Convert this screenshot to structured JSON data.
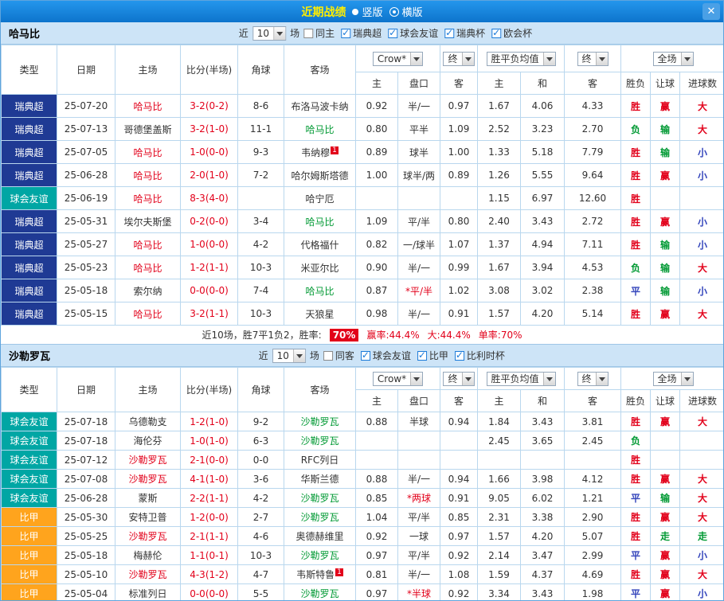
{
  "titlebar": {
    "title": "近期战绩",
    "radios": [
      {
        "label": "竖版",
        "selected": false
      },
      {
        "label": "横版",
        "selected": true
      }
    ],
    "close_icon": "✕"
  },
  "table_header": {
    "type": "类型",
    "date": "日期",
    "home": "主场",
    "score": "比分(半场)",
    "corner": "角球",
    "away": "客场",
    "odds_home": "主",
    "odds_handicap": "盘口",
    "odds_away": "客",
    "avg_home": "主",
    "avg_draw": "和",
    "avg_away": "客",
    "result_wdl": "胜负",
    "result_handicap": "让球",
    "result_goals": "进球数"
  },
  "league_colors": {
    "瑞典超": "#1f3a94",
    "球会友谊": "#00a6a4",
    "比甲": "#ffa41d"
  },
  "result_colors": {
    "胜": "#e2001a",
    "平": "#3344bb",
    "负": "#009933",
    "赢": "#e2001a",
    "输": "#009933",
    "走": "#009933",
    "大": "#e2001a",
    "小": "#3344bb"
  },
  "sections": [
    {
      "team": "哈马比",
      "filter": {
        "near": "近",
        "count": "10",
        "games": "场",
        "checkboxes": [
          {
            "label": "同主",
            "checked": false
          },
          {
            "label": "瑞典超",
            "checked": true
          },
          {
            "label": "球会友谊",
            "checked": true
          },
          {
            "label": "瑞典杯",
            "checked": true
          },
          {
            "label": "欧会杯",
            "checked": true
          }
        ]
      },
      "dropdowns": {
        "company": "Crow*",
        "final1": "终",
        "avg": "胜平负均值",
        "final2": "终",
        "scope": "全场"
      },
      "rows": [
        {
          "league": "瑞典超",
          "date": "25-07-20",
          "home": "哈马比",
          "home_cls": "t-red",
          "score": "3-2(0-2)",
          "corner": "8-6",
          "away": "布洛马波卡纳",
          "away_cls": "",
          "odds": [
            "0.92",
            "半/一",
            "0.97"
          ],
          "avg": [
            "1.67",
            "4.06",
            "4.33"
          ],
          "res": [
            "胜",
            "赢",
            "大"
          ]
        },
        {
          "league": "瑞典超",
          "date": "25-07-13",
          "home": "哥德堡盖斯",
          "home_cls": "",
          "score": "3-2(1-0)",
          "corner": "11-1",
          "away": "哈马比",
          "away_cls": "t-green",
          "odds": [
            "0.80",
            "平半",
            "1.09"
          ],
          "avg": [
            "2.52",
            "3.23",
            "2.70"
          ],
          "res": [
            "负",
            "输",
            "大"
          ]
        },
        {
          "league": "瑞典超",
          "date": "25-07-05",
          "home": "哈马比",
          "home_cls": "t-red",
          "score": "1-0(0-0)",
          "corner": "9-3",
          "away": "韦纳穆",
          "away_cls": "",
          "away_badge": "1",
          "odds": [
            "0.89",
            "球半",
            "1.00"
          ],
          "avg": [
            "1.33",
            "5.18",
            "7.79"
          ],
          "res": [
            "胜",
            "输",
            "小"
          ]
        },
        {
          "league": "瑞典超",
          "date": "25-06-28",
          "home": "哈马比",
          "home_cls": "t-red",
          "score": "2-0(1-0)",
          "corner": "7-2",
          "away": "哈尔姆斯塔德",
          "away_cls": "",
          "odds": [
            "1.00",
            "球半/两",
            "0.89"
          ],
          "avg": [
            "1.26",
            "5.55",
            "9.64"
          ],
          "res": [
            "胜",
            "赢",
            "小"
          ]
        },
        {
          "league": "球会友谊",
          "date": "25-06-19",
          "home": "哈马比",
          "home_cls": "t-red",
          "score": "8-3(4-0)",
          "corner": "",
          "away": "哈宁厄",
          "away_cls": "",
          "odds": [
            "",
            "",
            ""
          ],
          "avg": [
            "1.15",
            "6.97",
            "12.60"
          ],
          "res": [
            "胜",
            "",
            ""
          ]
        },
        {
          "league": "瑞典超",
          "date": "25-05-31",
          "home": "埃尔夫斯堡",
          "home_cls": "",
          "score": "0-2(0-0)",
          "corner": "3-4",
          "away": "哈马比",
          "away_cls": "t-green",
          "odds": [
            "1.09",
            "平/半",
            "0.80"
          ],
          "avg": [
            "2.40",
            "3.43",
            "2.72"
          ],
          "res": [
            "胜",
            "赢",
            "小"
          ]
        },
        {
          "league": "瑞典超",
          "date": "25-05-27",
          "home": "哈马比",
          "home_cls": "t-red",
          "score": "1-0(0-0)",
          "corner": "4-2",
          "away": "代格福什",
          "away_cls": "",
          "odds": [
            "0.82",
            "一/球半",
            "1.07"
          ],
          "avg": [
            "1.37",
            "4.94",
            "7.11"
          ],
          "res": [
            "胜",
            "输",
            "小"
          ]
        },
        {
          "league": "瑞典超",
          "date": "25-05-23",
          "home": "哈马比",
          "home_cls": "t-red",
          "score": "1-2(1-1)",
          "corner": "10-3",
          "away": "米亚尔比",
          "away_cls": "",
          "odds": [
            "0.90",
            "半/一",
            "0.99"
          ],
          "avg": [
            "1.67",
            "3.94",
            "4.53"
          ],
          "res": [
            "负",
            "输",
            "大"
          ]
        },
        {
          "league": "瑞典超",
          "date": "25-05-18",
          "home": "索尔纳",
          "home_cls": "",
          "score": "0-0(0-0)",
          "corner": "7-4",
          "away": "哈马比",
          "away_cls": "t-green",
          "odds": [
            "0.87",
            "*平/半",
            "1.02"
          ],
          "avg": [
            "3.08",
            "3.02",
            "2.38"
          ],
          "res": [
            "平",
            "输",
            "小"
          ]
        },
        {
          "league": "瑞典超",
          "date": "25-05-15",
          "home": "哈马比",
          "home_cls": "t-red",
          "score": "3-2(1-1)",
          "corner": "10-3",
          "away": "天狼星",
          "away_cls": "",
          "odds": [
            "0.98",
            "半/一",
            "0.91"
          ],
          "avg": [
            "1.57",
            "4.20",
            "5.14"
          ],
          "res": [
            "胜",
            "赢",
            "大"
          ]
        }
      ],
      "summary": {
        "prefix": "近10场，胜7平1负2，胜率:",
        "rate": "70%",
        "stats": [
          "赢率:44.4%",
          "大:44.4%",
          "单率:70%"
        ]
      }
    },
    {
      "team": "沙勒罗瓦",
      "filter": {
        "near": "近",
        "count": "10",
        "games": "场",
        "checkboxes": [
          {
            "label": "同客",
            "checked": false
          },
          {
            "label": "球会友谊",
            "checked": true
          },
          {
            "label": "比甲",
            "checked": true
          },
          {
            "label": "比利时杯",
            "checked": true
          }
        ]
      },
      "dropdowns": {
        "company": "Crow*",
        "final1": "终",
        "avg": "胜平负均值",
        "final2": "终",
        "scope": "全场"
      },
      "rows": [
        {
          "league": "球会友谊",
          "date": "25-07-18",
          "home": "乌德勒支",
          "home_cls": "",
          "score": "1-2(1-0)",
          "corner": "9-2",
          "away": "沙勒罗瓦",
          "away_cls": "t-green",
          "odds": [
            "0.88",
            "半球",
            "0.94"
          ],
          "avg": [
            "1.84",
            "3.43",
            "3.81"
          ],
          "res": [
            "胜",
            "赢",
            "大"
          ]
        },
        {
          "league": "球会友谊",
          "date": "25-07-18",
          "home": "海伦芬",
          "home_cls": "",
          "score": "1-0(1-0)",
          "corner": "6-3",
          "away": "沙勒罗瓦",
          "away_cls": "t-green",
          "odds": [
            "",
            "",
            ""
          ],
          "avg": [
            "2.45",
            "3.65",
            "2.45"
          ],
          "res": [
            "负",
            "",
            ""
          ]
        },
        {
          "league": "球会友谊",
          "date": "25-07-12",
          "home": "沙勒罗瓦",
          "home_cls": "t-red",
          "score": "2-1(0-0)",
          "corner": "0-0",
          "away": "RFC列日",
          "away_cls": "",
          "odds": [
            "",
            "",
            ""
          ],
          "avg": [
            "",
            "",
            ""
          ],
          "res": [
            "胜",
            "",
            ""
          ]
        },
        {
          "league": "球会友谊",
          "date": "25-07-08",
          "home": "沙勒罗瓦",
          "home_cls": "t-red",
          "score": "4-1(1-0)",
          "corner": "3-6",
          "away": "华斯兰德",
          "away_cls": "",
          "odds": [
            "0.88",
            "半/一",
            "0.94"
          ],
          "avg": [
            "1.66",
            "3.98",
            "4.12"
          ],
          "res": [
            "胜",
            "赢",
            "大"
          ]
        },
        {
          "league": "球会友谊",
          "date": "25-06-28",
          "home": "蒙斯",
          "home_cls": "",
          "score": "2-2(1-1)",
          "corner": "4-2",
          "away": "沙勒罗瓦",
          "away_cls": "t-green",
          "odds": [
            "0.85",
            "*两球",
            "0.91"
          ],
          "avg": [
            "9.05",
            "6.02",
            "1.21"
          ],
          "res": [
            "平",
            "输",
            "大"
          ]
        },
        {
          "league": "比甲",
          "date": "25-05-30",
          "home": "安特卫普",
          "home_cls": "",
          "score": "1-2(0-0)",
          "corner": "2-7",
          "away": "沙勒罗瓦",
          "away_cls": "t-green",
          "odds": [
            "1.04",
            "平/半",
            "0.85"
          ],
          "avg": [
            "2.31",
            "3.38",
            "2.90"
          ],
          "res": [
            "胜",
            "赢",
            "大"
          ]
        },
        {
          "league": "比甲",
          "date": "25-05-25",
          "home": "沙勒罗瓦",
          "home_cls": "t-red",
          "score": "2-1(1-1)",
          "corner": "4-6",
          "away": "奥德赫维里",
          "away_cls": "",
          "odds": [
            "0.92",
            "一球",
            "0.97"
          ],
          "avg": [
            "1.57",
            "4.20",
            "5.07"
          ],
          "res": [
            "胜",
            "走",
            "走"
          ]
        },
        {
          "league": "比甲",
          "date": "25-05-18",
          "home": "梅赫伦",
          "home_cls": "",
          "score": "1-1(0-1)",
          "corner": "10-3",
          "away": "沙勒罗瓦",
          "away_cls": "t-green",
          "odds": [
            "0.97",
            "平/半",
            "0.92"
          ],
          "avg": [
            "2.14",
            "3.47",
            "2.99"
          ],
          "res": [
            "平",
            "赢",
            "小"
          ]
        },
        {
          "league": "比甲",
          "date": "25-05-10",
          "home": "沙勒罗瓦",
          "home_cls": "t-red",
          "score": "4-3(1-2)",
          "corner": "4-7",
          "away": "韦斯特鲁",
          "away_cls": "",
          "away_badge": "1",
          "odds": [
            "0.81",
            "半/一",
            "1.08"
          ],
          "avg": [
            "1.59",
            "4.37",
            "4.69"
          ],
          "res": [
            "胜",
            "赢",
            "大"
          ]
        },
        {
          "league": "比甲",
          "date": "25-05-04",
          "home": "标准列日",
          "home_cls": "",
          "score": "0-0(0-0)",
          "corner": "5-5",
          "away": "沙勒罗瓦",
          "away_cls": "t-green",
          "odds": [
            "0.97",
            "*半球",
            "0.92"
          ],
          "avg": [
            "3.34",
            "3.43",
            "1.98"
          ],
          "res": [
            "平",
            "赢",
            "小"
          ]
        }
      ]
    }
  ]
}
